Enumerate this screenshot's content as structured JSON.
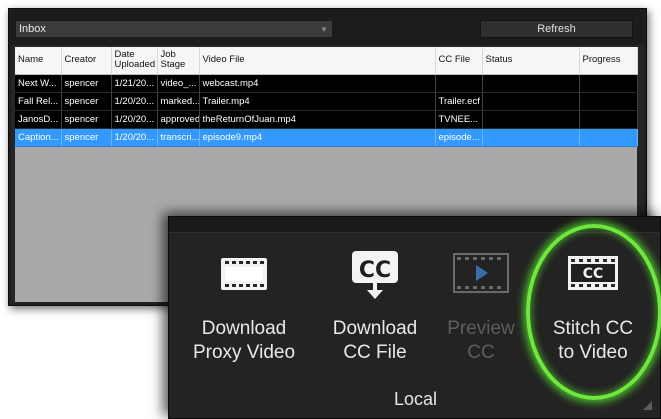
{
  "toolbar": {
    "inbox_value": "Inbox",
    "refresh_label": "Refresh"
  },
  "table": {
    "headers": [
      "Name",
      "Creator",
      "Date Uploaded",
      "Job Stage",
      "Video File",
      "CC File",
      "Status",
      "Progress"
    ],
    "rows": [
      [
        "Next W...",
        "spencer",
        "1/21/20...",
        "video_...",
        "webcast.mp4",
        "",
        "",
        ""
      ],
      [
        "Fall Rel...",
        "spencer",
        "1/20/20...",
        "marked...",
        "Trailer.mp4",
        "Trailer.ecf",
        "",
        ""
      ],
      [
        "JanosD...",
        "spencer",
        "1/20/20...",
        "approved",
        "theReturnOfJuan.mp4",
        "TVNEE...",
        "",
        ""
      ],
      [
        "Caption...",
        "spencer",
        "1/20/20...",
        "transcri...",
        "episode9.mp4",
        "episode...",
        "",
        ""
      ]
    ],
    "selected_row": 3
  },
  "ribbon": {
    "download_proxy": {
      "line1": "Download",
      "line2": "Proxy Video",
      "icon": "film-strip-icon"
    },
    "download_cc": {
      "line1": "Download",
      "line2": "CC File",
      "icon": "cc-download-icon"
    },
    "preview_cc": {
      "line1": "Preview",
      "line2": "CC",
      "icon": "film-play-icon"
    },
    "stitch_cc": {
      "line1": "Stitch CC",
      "line2": "to Video",
      "icon": "cc-film-icon"
    },
    "group_label": "Local"
  },
  "colors": {
    "selection": "#3399ff",
    "highlight_ring": "#6ee83c"
  }
}
